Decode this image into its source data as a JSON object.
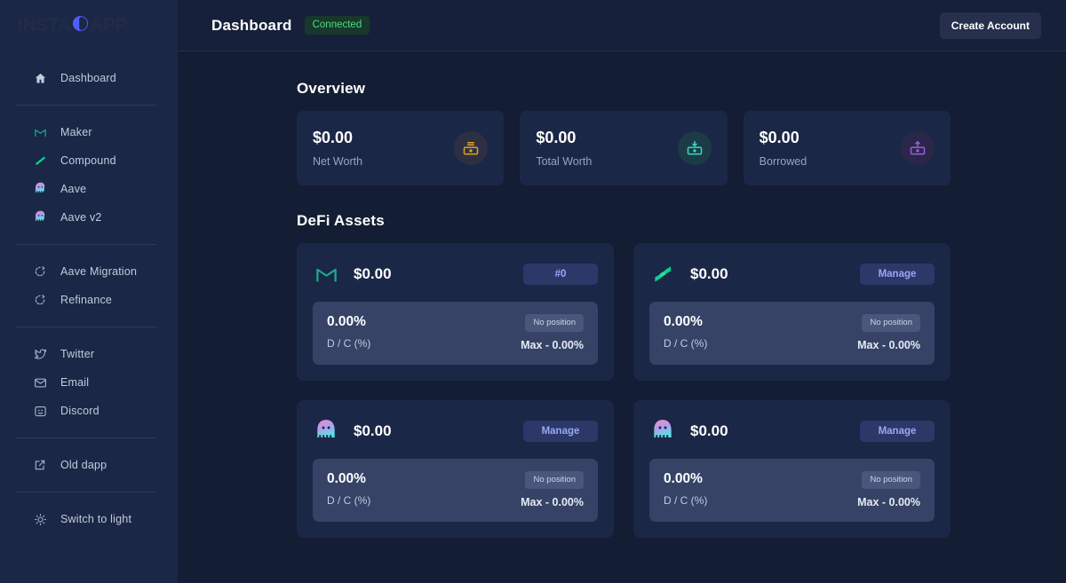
{
  "brand": {
    "name_left": "INSTA",
    "name_right": "APP",
    "mark_icon": "instadapp-circle-icon",
    "mark_color": "#4f5dfb"
  },
  "header": {
    "title": "Dashboard",
    "status_badge": "Connected",
    "status_color": "#4ade80",
    "create_account_label": "Create Account"
  },
  "sidebar": {
    "groups": [
      {
        "items": [
          {
            "label": "Dashboard",
            "icon": "home-icon"
          }
        ]
      },
      {
        "items": [
          {
            "label": "Maker",
            "icon": "maker-icon"
          },
          {
            "label": "Compound",
            "icon": "compound-icon"
          },
          {
            "label": "Aave",
            "icon": "aave-ghost-icon"
          },
          {
            "label": "Aave v2",
            "icon": "aave-ghost-icon"
          }
        ]
      },
      {
        "items": [
          {
            "label": "Aave Migration",
            "icon": "refresh-circle-icon"
          },
          {
            "label": "Refinance",
            "icon": "refresh-circle-icon"
          }
        ]
      },
      {
        "items": [
          {
            "label": "Twitter",
            "icon": "twitter-icon"
          },
          {
            "label": "Email",
            "icon": "mail-icon"
          },
          {
            "label": "Discord",
            "icon": "discord-icon"
          }
        ]
      },
      {
        "items": [
          {
            "label": "Old dapp",
            "icon": "external-link-icon"
          }
        ]
      },
      {
        "items": [
          {
            "label": "Switch to light",
            "icon": "sun-icon"
          }
        ]
      }
    ]
  },
  "overview": {
    "title": "Overview",
    "cards": [
      {
        "value": "$0.00",
        "label": "Net Worth",
        "icon": "banknote-icon",
        "accent": "#e0a325"
      },
      {
        "value": "$0.00",
        "label": "Total Worth",
        "icon": "banknote-down-icon",
        "accent": "#3dd6c4"
      },
      {
        "value": "$0.00",
        "label": "Borrowed",
        "icon": "banknote-up-icon",
        "accent": "#a05ce0"
      }
    ]
  },
  "defi_assets": {
    "title": "DeFi Assets",
    "cards": [
      {
        "protocol": "Maker",
        "logo": "maker-icon",
        "amount": "$0.00",
        "action_label": "#0",
        "ratio": "0.00%",
        "ratio_label": "D / C (%)",
        "status": "No position",
        "max": "Max - 0.00%"
      },
      {
        "protocol": "Compound",
        "logo": "compound-icon",
        "amount": "$0.00",
        "action_label": "Manage",
        "ratio": "0.00%",
        "ratio_label": "D / C (%)",
        "status": "No position",
        "max": "Max - 0.00%"
      },
      {
        "protocol": "Aave",
        "logo": "aave-ghost-icon",
        "amount": "$0.00",
        "action_label": "Manage",
        "ratio": "0.00%",
        "ratio_label": "D / C (%)",
        "status": "No position",
        "max": "Max - 0.00%"
      },
      {
        "protocol": "Aave v2",
        "logo": "aave-ghost-icon",
        "amount": "$0.00",
        "action_label": "Manage",
        "ratio": "0.00%",
        "ratio_label": "D / C (%)",
        "status": "No position",
        "max": "Max - 0.00%"
      }
    ]
  }
}
